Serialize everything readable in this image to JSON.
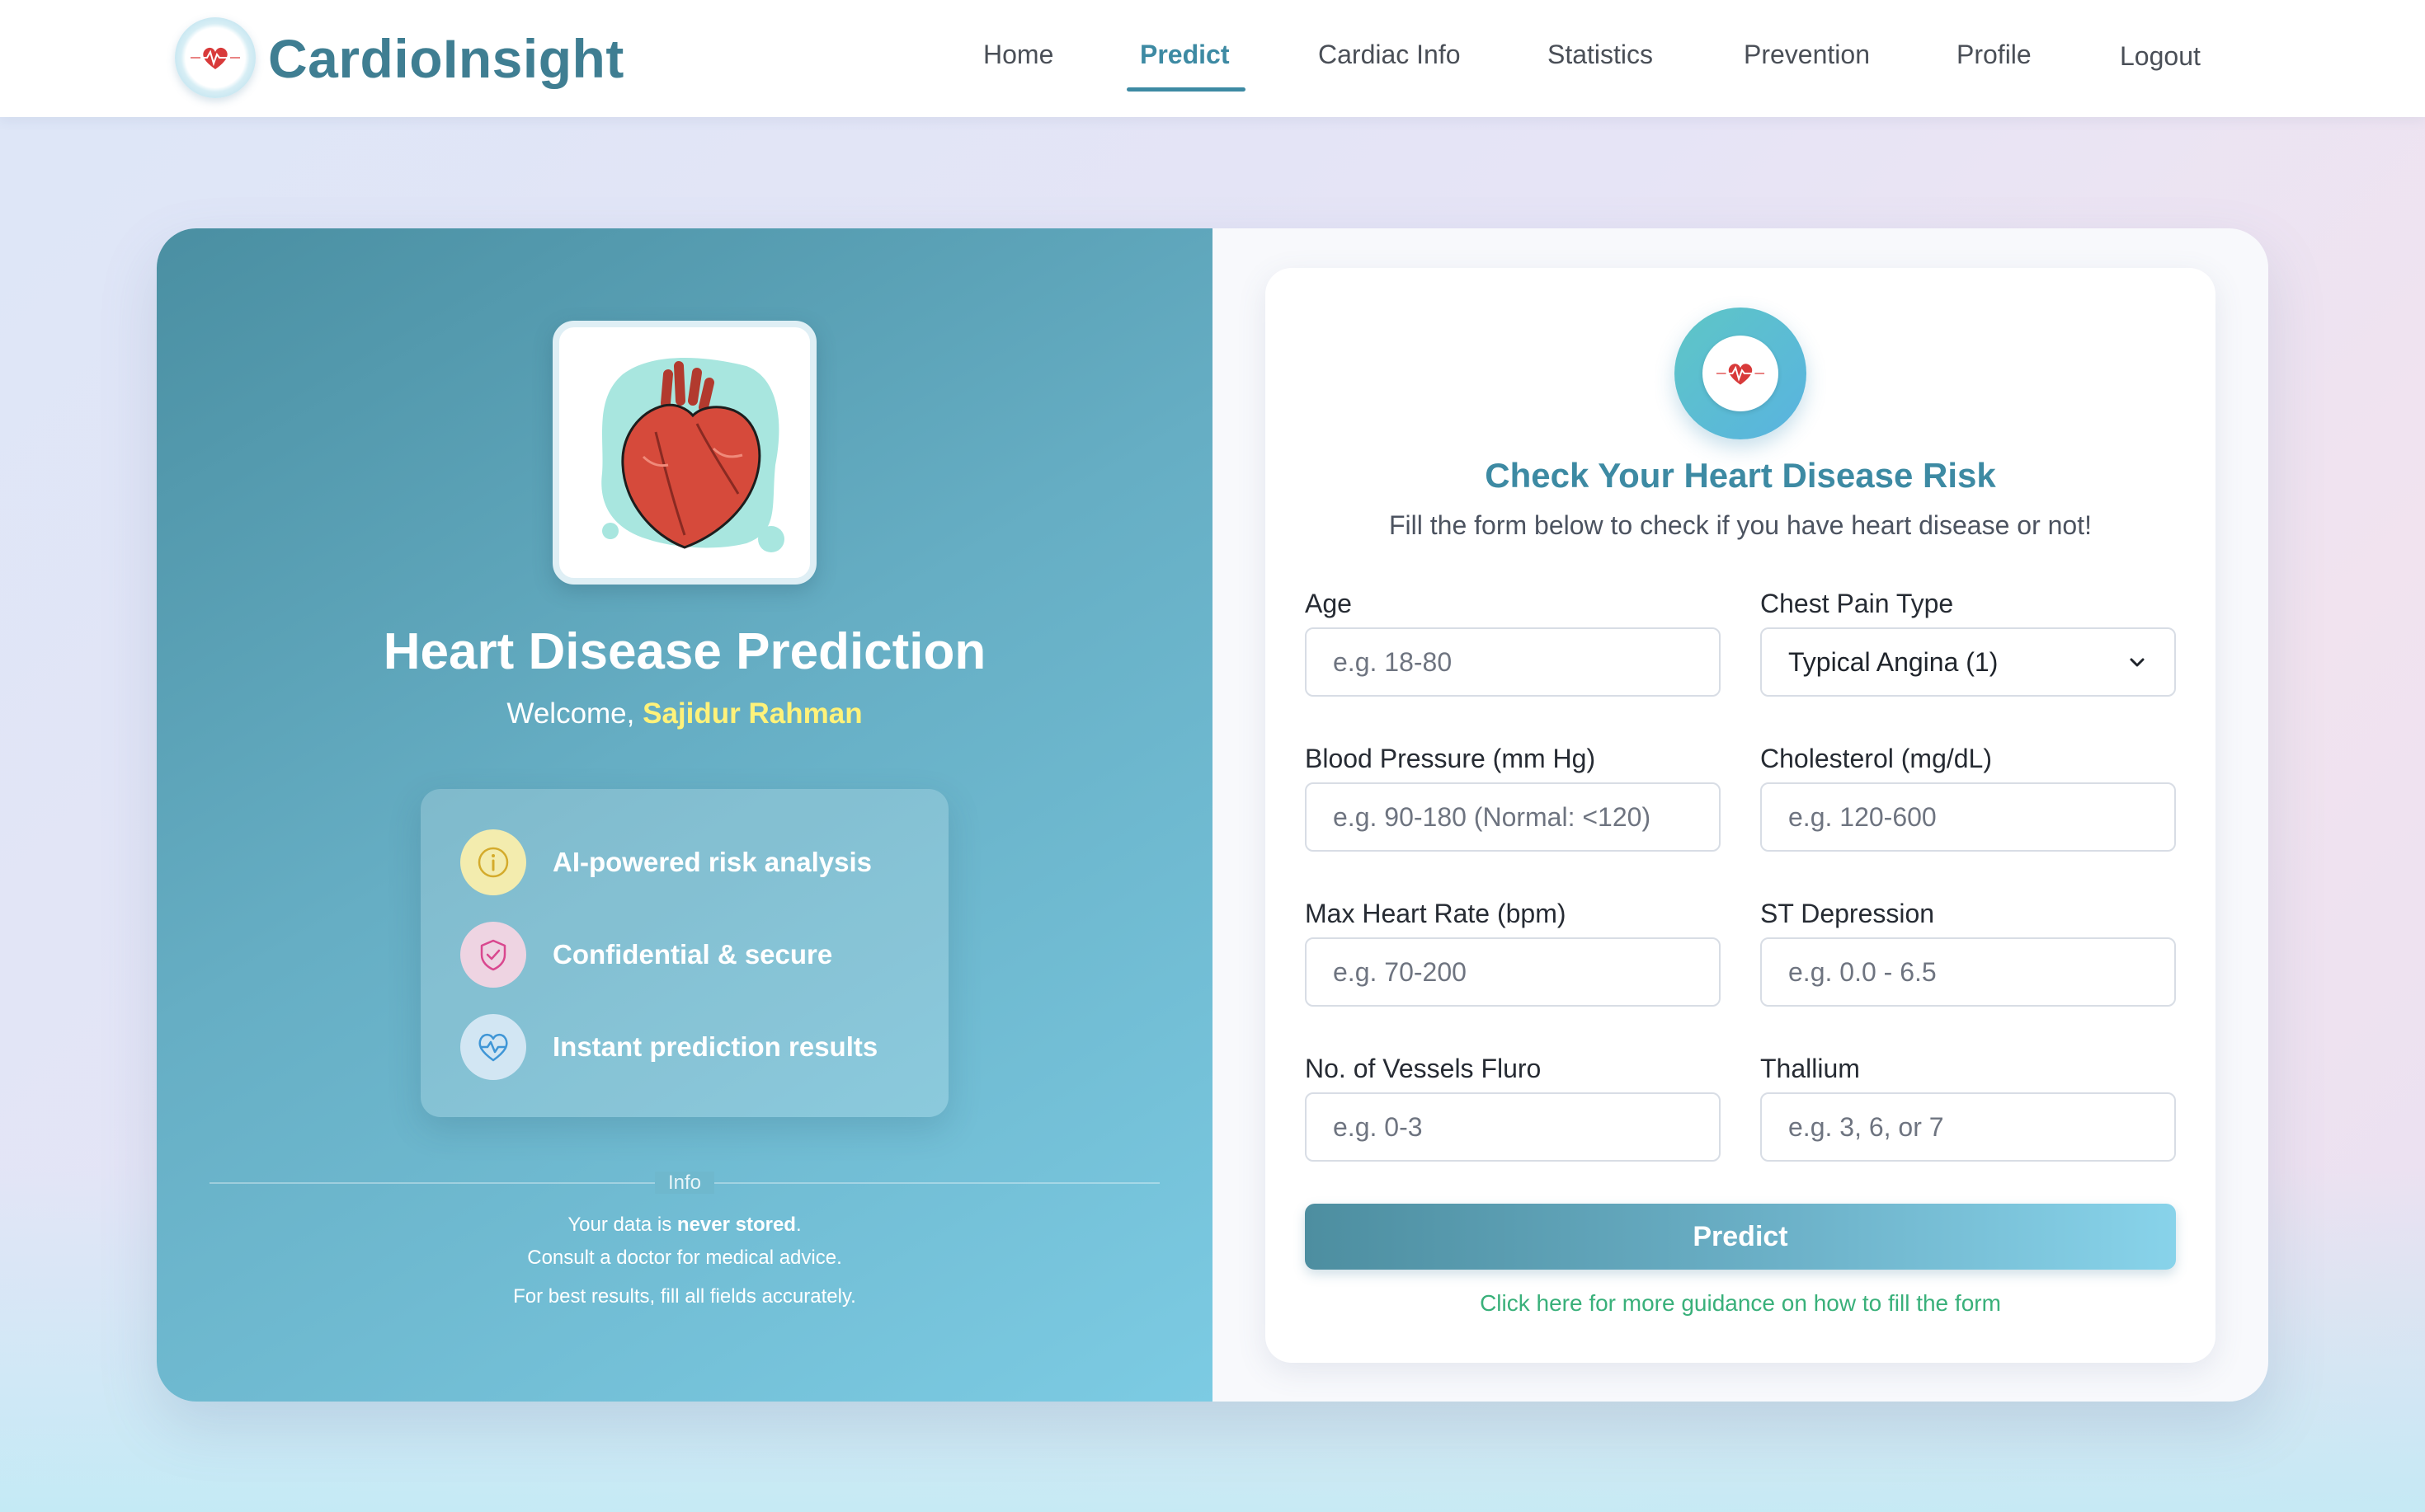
{
  "brand": {
    "name": "CardioInsight",
    "logo_icon": "heart-ecg-icon"
  },
  "nav": {
    "items": [
      {
        "label": "Home",
        "active": false
      },
      {
        "label": "Predict",
        "active": true
      },
      {
        "label": "Cardiac Info",
        "active": false
      },
      {
        "label": "Statistics",
        "active": false
      },
      {
        "label": "Prevention",
        "active": false
      },
      {
        "label": "Profile",
        "active": false
      },
      {
        "label": "Logout",
        "active": false
      }
    ],
    "active_color": "#3d8aa3"
  },
  "left": {
    "image_icon": "anatomical-heart-icon",
    "title": "Heart Disease Prediction",
    "welcome_prefix": "Welcome,",
    "user_name": "Sajidur Rahman",
    "features": [
      {
        "icon": "info-icon",
        "text": "AI-powered risk analysis"
      },
      {
        "icon": "shield-check-icon",
        "text": "Confidential & secure"
      },
      {
        "icon": "heart-pulse-icon",
        "text": "Instant prediction results"
      }
    ],
    "info": {
      "label": "Info",
      "line1_prefix": "Your data is",
      "line1_bold": "never stored",
      "line1_suffix": ".",
      "line2": "Consult a doctor for medical advice.",
      "line3": "For best results, fill all fields accurately."
    }
  },
  "form": {
    "title": "Check Your Heart Disease Risk",
    "subtitle": "Fill the form below to check if you have heart disease or not!",
    "fields": {
      "age": {
        "label": "Age",
        "placeholder": "e.g. 18-80"
      },
      "chest_pain": {
        "label": "Chest Pain Type",
        "value": "Typical Angina (1)"
      },
      "blood_pressure": {
        "label": "Blood Pressure (mm Hg)",
        "placeholder": "e.g. 90-180 (Normal: <120)"
      },
      "cholesterol": {
        "label": "Cholesterol (mg/dL)",
        "placeholder": "e.g. 120-600"
      },
      "max_hr": {
        "label": "Max Heart Rate (bpm)",
        "placeholder": "e.g. 70-200"
      },
      "st_depression": {
        "label": "ST Depression",
        "placeholder": "e.g. 0.0 - 6.5"
      },
      "vessels": {
        "label": "No. of Vessels Fluro",
        "placeholder": "e.g. 0-3"
      },
      "thallium": {
        "label": "Thallium",
        "placeholder": "e.g. 3, 6, or 7"
      }
    },
    "submit_label": "Predict",
    "guidance_link": "Click here for more guidance on how to fill the form",
    "link_color": "#39b07a"
  }
}
